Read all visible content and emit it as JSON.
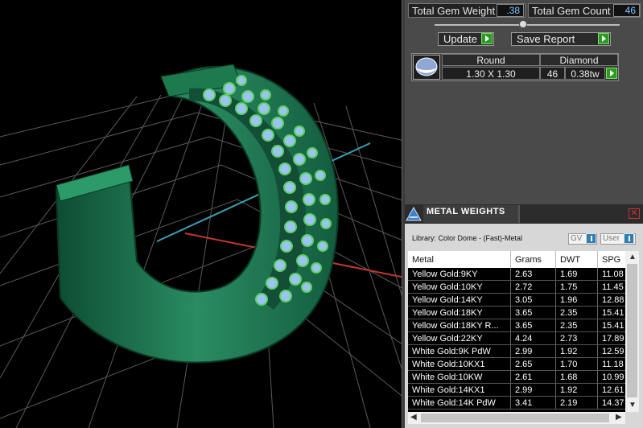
{
  "summary": {
    "weight_label": "Total Gem Weight",
    "weight_value": ".38",
    "count_label": "Total Gem Count",
    "count_value": "46",
    "update_label": "Update",
    "save_label": "Save Report",
    "slider_position": 0.48
  },
  "gem": {
    "cut": "Round",
    "stone": "Diamond",
    "size": "1.30 X 1.30",
    "count": "46",
    "weight": "0.38tw"
  },
  "metal_weights": {
    "title": "METAL WEIGHTS",
    "close_icon": "close-icon",
    "library": "Library: Color Dome - (Fast)-Metal",
    "gv_label": "GV",
    "user_label": "User",
    "columns": [
      "Metal",
      "Grams",
      "DWT",
      "SPG"
    ],
    "rows": [
      [
        "Yellow Gold:9KY",
        "2.63",
        "1.69",
        "11.08"
      ],
      [
        "Yellow Gold:10KY",
        "2.72",
        "1.75",
        "11.45"
      ],
      [
        "Yellow Gold:14KY",
        "3.05",
        "1.96",
        "12.88"
      ],
      [
        "Yellow Gold:18KY",
        "3.65",
        "2.35",
        "15.41"
      ],
      [
        "Yellow Gold:18KY R...",
        "3.65",
        "2.35",
        "15.41"
      ],
      [
        "Yellow Gold:22KY",
        "4.24",
        "2.73",
        "17.89"
      ],
      [
        "White Gold:9K PdW",
        "2.99",
        "1.92",
        "12.59"
      ],
      [
        "White Gold:10KX1",
        "2.65",
        "1.70",
        "11.18"
      ],
      [
        "White Gold:10KW",
        "2.61",
        "1.68",
        "10.99"
      ],
      [
        "White Gold:14KX1",
        "2.99",
        "1.92",
        "12.61"
      ],
      [
        "White Gold:14K PdW",
        "3.41",
        "2.19",
        "14.37"
      ]
    ]
  },
  "colors": {
    "ring": "#1f7a52",
    "gems": "#9bc4f2",
    "prongs": "#5fd060",
    "accent_green": "#2e9a24",
    "value_blue": "#7cc6ff"
  }
}
